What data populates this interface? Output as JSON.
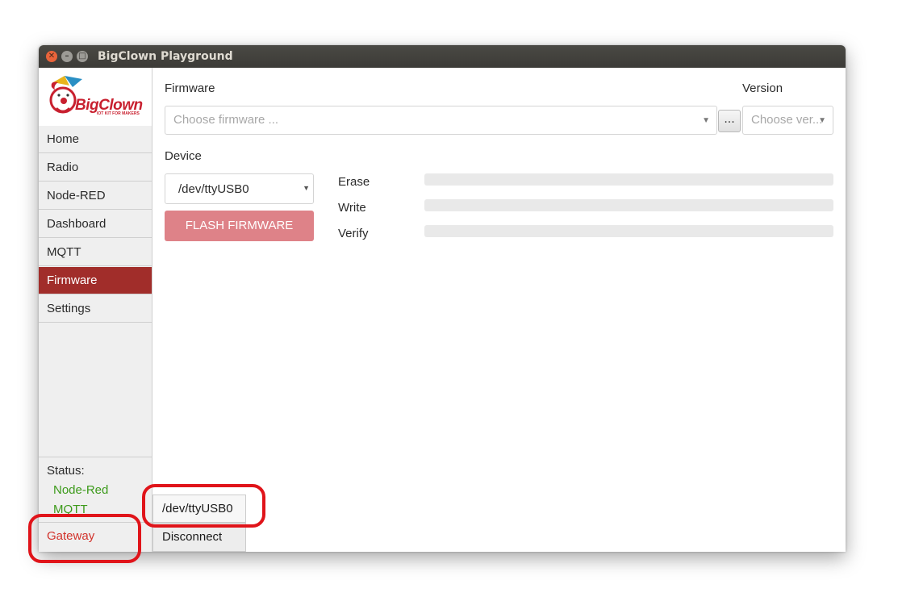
{
  "window": {
    "title": "BigClown Playground"
  },
  "logo": {
    "name": "BigClown",
    "tagline": "IOT KIT FOR MAKERS"
  },
  "sidebar": {
    "items": [
      {
        "label": "Home"
      },
      {
        "label": "Radio"
      },
      {
        "label": "Node-RED"
      },
      {
        "label": "Dashboard"
      },
      {
        "label": "MQTT"
      },
      {
        "label": "Firmware",
        "active": true
      },
      {
        "label": "Settings"
      }
    ],
    "status": {
      "label": "Status:",
      "items": [
        "Node-Red",
        "MQTT"
      ]
    },
    "gateway": "Gateway"
  },
  "firmware": {
    "firmware_label": "Firmware",
    "firmware_placeholder": "Choose firmware ...",
    "browse_label": "...",
    "version_label": "Version",
    "version_placeholder": "Choose ver...",
    "device_label": "Device",
    "device_value": "/dev/ttyUSB0",
    "flash_button": "FLASH FIRMWARE",
    "steps": [
      {
        "label": "Erase",
        "progress": 0
      },
      {
        "label": "Write",
        "progress": 0
      },
      {
        "label": "Verify",
        "progress": 0
      }
    ]
  },
  "bottom": {
    "port": "/dev/ttyUSB0",
    "disconnect": "Disconnect"
  },
  "colors": {
    "accent": "#a12d2a",
    "flash_button": "#de8288",
    "status_ok": "#3c9a1a",
    "status_error": "#d2332c",
    "annotation": "#e0141a"
  }
}
